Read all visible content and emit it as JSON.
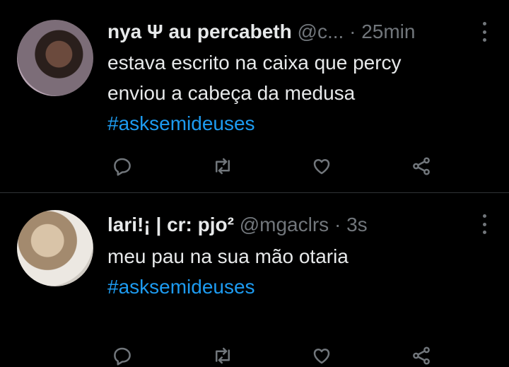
{
  "tweets": [
    {
      "display_name": "nya Ψ au percabeth",
      "handle": "@c...",
      "separator": "·",
      "time": "25min",
      "text_line1": "estava escrito na caixa que percy",
      "text_line2": "enviou a cabeça da medusa",
      "hashtag": "#asksemideuses"
    },
    {
      "display_name": "lari!¡ | cr: pjo²",
      "handle": "@mgaclrs",
      "separator": "·",
      "time": "3s",
      "text_line1": "meu pau na sua mão otaria",
      "hashtag": "#asksemideuses"
    }
  ],
  "colors": {
    "background": "#000000",
    "text": "#e7e9ea",
    "secondary": "#71767b",
    "link": "#1d9bf0",
    "divider": "#2f3336"
  },
  "icons": [
    "reply-icon",
    "retweet-icon",
    "like-icon",
    "share-icon",
    "more-icon"
  ]
}
